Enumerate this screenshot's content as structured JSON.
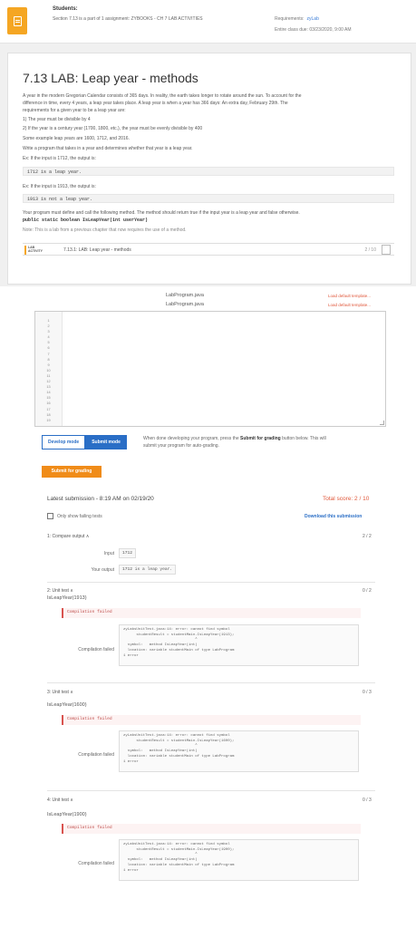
{
  "header": {
    "students": "Students:",
    "section_line": "Section 7.13 is a part of 1 assignment: ZYBOOKS - CH 7 LAB ACTIVITIES",
    "requirements_label": "Requirements:",
    "requirements_value": "zyLab",
    "entire_class_due": "Entire class due:  03/23/2020, 9:00 AM"
  },
  "lesson": {
    "title": "7.13 LAB: Leap year - methods",
    "para1_line1": "A year in the modern Gregorian Calendar consists of 365 days. In reality, the earth takes longer to rotate around the sun. To account for the",
    "para1_line2": "difference in time, every 4 years, a leap year takes place. A leap year is when a year has 366 days: An extra day, February 29th. The",
    "para1_line3": "requirements for a given year to be a leap year are:",
    "rule1": "1) The year must be divisible by 4",
    "rule2": "2) If the year is a century year (1700, 1800, etc.), the year must be evenly divisible by 400",
    "examples": "Some example leap years are 1600, 1712, and 2016.",
    "write_program": "Write a program that takes in a year and determines whether that year is a leap year.",
    "ex1_label": "Ex: If the input is 1712, the output is:",
    "ex1_output": "1712 is a leap year.",
    "ex2_label": "Ex: If the input is 1913, the output is:",
    "ex2_output": "1913 is not a leap year.",
    "method_line": "Your program must define and call the following method. The method should return true if the input year is a leap year and false otherwise.",
    "signature": "public static boolean IsLeapYear(int userYear)",
    "note": "Note: This is a lab from a previous chapter that now requires the use of a method."
  },
  "lab_activity": {
    "tag_line1": "LAB",
    "tag_line2": "ACTIVITY",
    "name": "7.13.1: LAB: Leap year - methods",
    "score": "2 / 10"
  },
  "editor": {
    "file1": "LabProgram.java",
    "file2": "LabProgram.java",
    "load_template_1": "Load default template...",
    "load_template_2": "Load default template...",
    "line_numbers": [
      "1",
      "2",
      "3",
      "4",
      "5",
      "6",
      "7",
      "8",
      "9",
      "10",
      "11",
      "12",
      "13",
      "14",
      "15",
      "16",
      "17",
      "18",
      "19"
    ]
  },
  "modes": {
    "develop": "Develop mode",
    "submit": "Submit mode",
    "help_part1": "When done developing your program, press the ",
    "help_bold": "Submit for grading",
    "help_part2": " button below. This will",
    "help_line2": "submit your program for auto-grading."
  },
  "submit_button": "Submit for grading",
  "submission": {
    "latest": "Latest submission - 8:19 AM on 02/19/20",
    "total": "Total score: 2 / 10",
    "only_failing": "Only show failing tests",
    "download": "Download this submission"
  },
  "tests": [
    {
      "title": "1: Compare output ∧",
      "score": "2 / 2",
      "input_label": "Input",
      "input_value": "1712",
      "output_label": "Your output",
      "output_value": "1712 is a leap year."
    },
    {
      "title": "2: Unit test ∧",
      "score": "0 / 2",
      "function": "IsLeapYear(1913)",
      "banner": "Compilation failed",
      "label": "Compilation failed",
      "err": [
        "zyLabsUnitTest.java:14: error: cannot find symbol",
        "      studentResult = studentMain.IsLeapYear(1913);",
        "                                 ^",
        "  symbol:   method IsLeapYear(int)",
        "  location: variable studentMain of type LabProgram",
        "1 error"
      ]
    },
    {
      "title": "3: Unit test ∧",
      "score": "0 / 3",
      "function": "IsLeapYear(1600)",
      "banner": "Compilation failed",
      "label": "Compilation failed",
      "err": [
        "zyLabsUnitTest.java:14: error: cannot find symbol",
        "      studentResult = studentMain.IsLeapYear(1600);",
        "                                 ^",
        "  symbol:   method IsLeapYear(int)",
        "  location: variable studentMain of type LabProgram",
        "1 error"
      ]
    },
    {
      "title": "4: Unit test ∧",
      "score": "0 / 3",
      "function": "IsLeapYear(1900)",
      "banner": "Compilation failed",
      "label": "Compilation failed",
      "err": [
        "zyLabsUnitTest.java:14: error: cannot find symbol",
        "      studentResult = studentMain.IsLeapYear(1900);",
        "                                 ^",
        "  symbol:   method IsLeapYear(int)",
        "  location: variable studentMain of type LabProgram",
        "1 error"
      ]
    }
  ]
}
